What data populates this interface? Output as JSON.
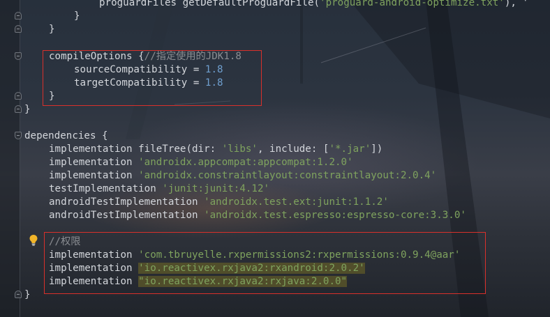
{
  "code": {
    "l1_text": "proguardFiles getDefaultProguardFile(",
    "l1_str": "'proguard-android-optimize.txt'",
    "l1_tail": "), '",
    "l2": "}",
    "l3": "}",
    "l5_text": "compileOptions {",
    "l5_cmt": "//指定使用的JDK1.8",
    "l6_text": "sourceCompatibility = ",
    "l6_num": "1.8",
    "l7_text": "targetCompatibility = ",
    "l7_num": "1.8",
    "l8": "}",
    "l9": "}",
    "l11": "dependencies {",
    "l12_a": "implementation fileTree(",
    "l12_b": "dir: ",
    "l12_c": "'libs'",
    "l12_d": ", include: [",
    "l12_e": "'*.jar'",
    "l12_f": "])",
    "l13_a": "implementation ",
    "l13_s": "'androidx.appcompat:appcompat:1.2.0'",
    "l14_a": "implementation ",
    "l14_s": "'androidx.constraintlayout:constraintlayout:2.0.4'",
    "l15_a": "testImplementation ",
    "l15_s": "'junit:junit:4.12'",
    "l16_a": "androidTestImplementation ",
    "l16_s": "'androidx.test.ext:junit:1.1.2'",
    "l17_a": "androidTestImplementation ",
    "l17_s": "'androidx.test.espresso:espresso-core:3.3.0'",
    "l19_cmt": "//权限",
    "l20_a": "implementation ",
    "l20_s": "'com.tbruyelle.rxpermissions2:rxpermissions:0.9.4@aar'",
    "l21_a": "implementation ",
    "l21_s": "'io.reactivex.rxjava2:rxandroid:2.0.2'",
    "l22_a": "implementation ",
    "l22_s": "\"io.reactivex.rxjava2:rxjava:2.0.0\"",
    "l23": "}"
  },
  "icons": {
    "gutter_fold": "fold-marker-icon",
    "intention": "lightbulb-icon"
  },
  "colors": {
    "string": "#7fa35e",
    "number": "#6f9fcf",
    "comment": "#8a8d92",
    "highlight_box": "#d9302b",
    "warning_bg": "#5f5a28"
  }
}
